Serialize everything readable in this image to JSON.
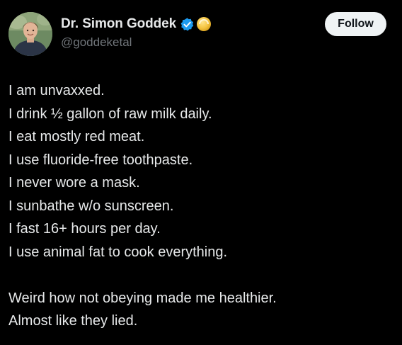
{
  "author": {
    "display_name": "Dr. Simon Goddek",
    "handle": "@goddeketal",
    "avatar_icon": "profile-photo",
    "verified_icon": "verified-badge-icon",
    "affiliate_icon": "gold-circle-icon"
  },
  "follow_label": "Follow",
  "tweet": {
    "lines": [
      "I am unvaxxed.",
      "I drink ½ gallon of raw milk daily.",
      "I eat mostly red meat.",
      "I use fluoride-free toothpaste.",
      "I never wore a mask.",
      "I sunbathe w/o sunscreen.",
      "I fast 16+ hours per day.",
      "I use animal fat to cook everything."
    ],
    "closing": [
      "Weird how not obeying made me healthier.",
      "Almost like they lied."
    ]
  },
  "colors": {
    "background": "#000000",
    "text": "#e7e9ea",
    "secondary_text": "#71767b",
    "verified_blue": "#1d9bf0",
    "gold": "#f5c542",
    "button_bg": "#eff3f4",
    "button_text": "#0f1419"
  }
}
